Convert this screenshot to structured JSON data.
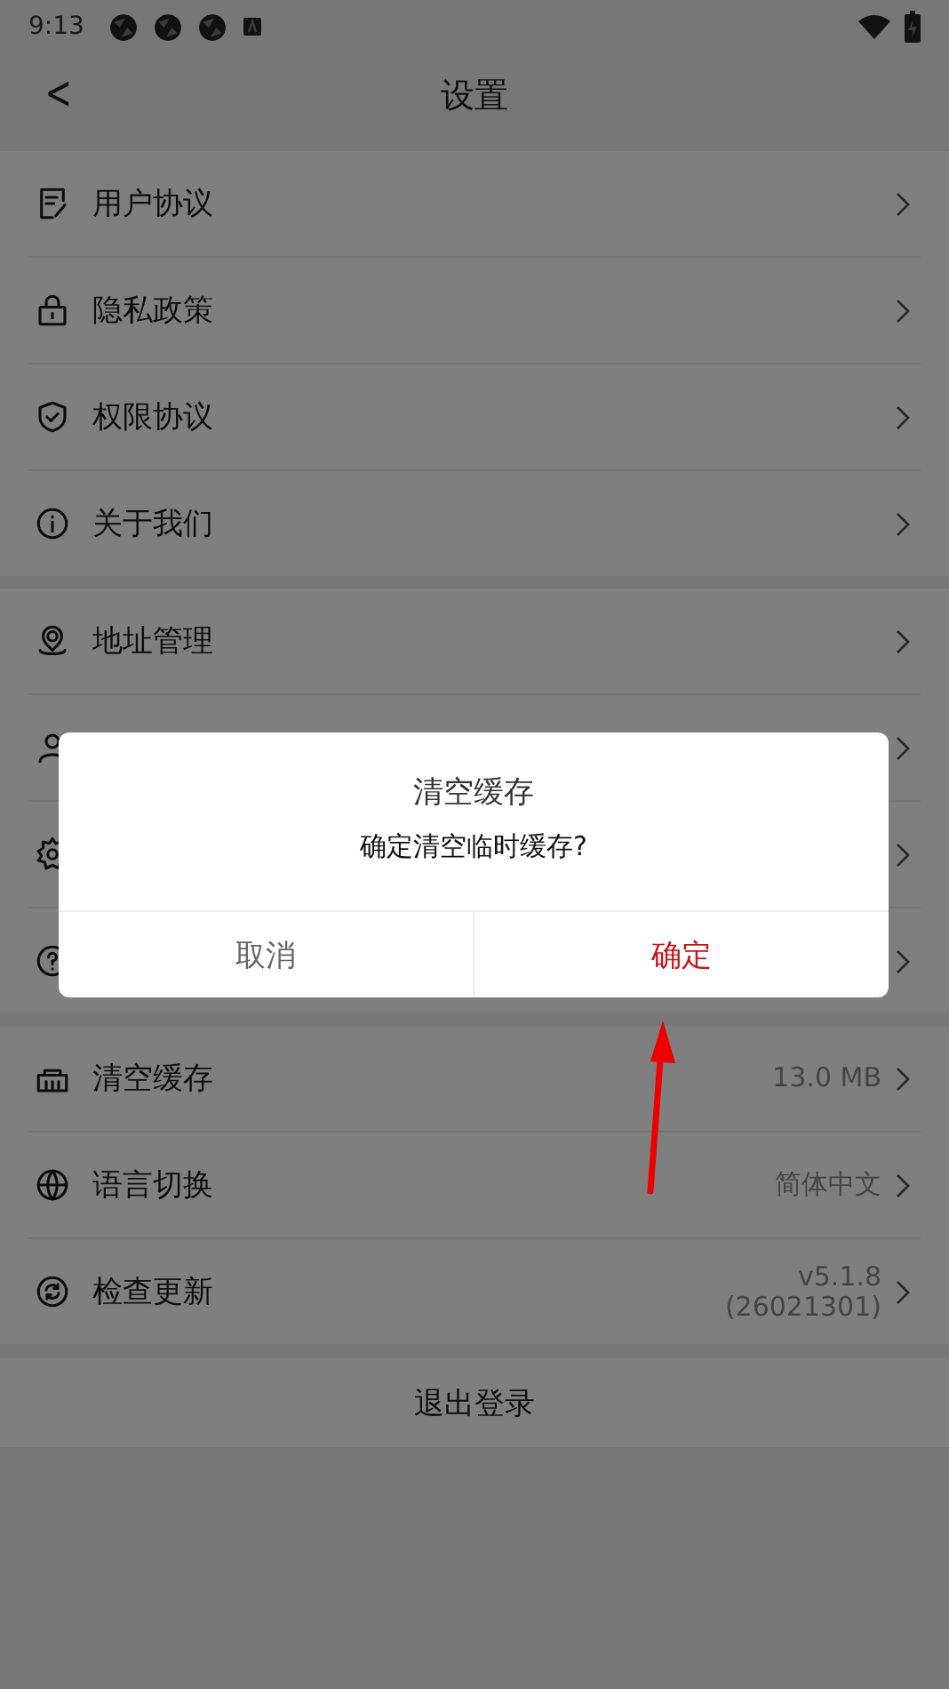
{
  "status_bar": {
    "time": "9:13"
  },
  "header": {
    "back": "<",
    "title": "设置"
  },
  "sections": [
    {
      "rows": [
        {
          "label": "用户协议"
        },
        {
          "label": "隐私政策"
        },
        {
          "label": "权限协议"
        },
        {
          "label": "关于我们"
        }
      ]
    },
    {
      "rows": [
        {
          "label": "地址管理"
        },
        {},
        {},
        {}
      ]
    },
    {
      "rows": [
        {
          "label": "清空缓存",
          "value": [
            "13.0 MB"
          ]
        },
        {
          "label": "语言切换",
          "value": [
            "简体中文"
          ]
        },
        {
          "label": "检查更新",
          "value": [
            "v5.1.8",
            "(26021301)"
          ]
        }
      ]
    }
  ],
  "logout": "退出登录",
  "dialog": {
    "title": "清空缓存",
    "message": "确定清空临时缓存?",
    "buttons": [
      {
        "label": "取消",
        "kind": "cancel"
      },
      {
        "label": "确定",
        "kind": "confirm"
      }
    ]
  }
}
